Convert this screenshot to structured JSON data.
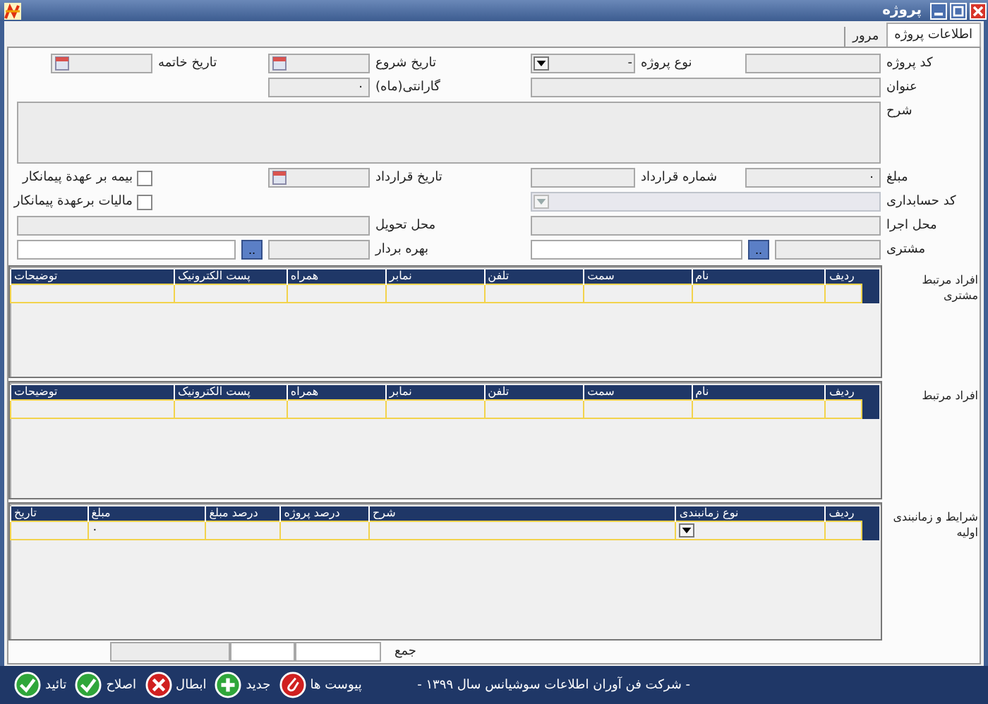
{
  "window": {
    "title": "پروژه"
  },
  "tabs": [
    {
      "label": "اطلاعات پروژه",
      "selected": true
    },
    {
      "label": "مرور",
      "selected": false
    }
  ],
  "fields": {
    "project_code": {
      "label": "کد پروژه"
    },
    "project_type": {
      "label": "نوع پروژه",
      "value": "-"
    },
    "start_date": {
      "label": "تاریخ شروع"
    },
    "end_date": {
      "label": "تاریخ خاتمه"
    },
    "title": {
      "label": "عنوان"
    },
    "warranty": {
      "label": "گارانتی(ماه)",
      "value": "٠"
    },
    "description": {
      "label": "شرح"
    },
    "amount": {
      "label": "مبلغ",
      "value": "٠"
    },
    "contract_number": {
      "label": "شماره قرارداد"
    },
    "contract_date": {
      "label": "تاریخ قرارداد"
    },
    "accounting_code": {
      "label": "کد حسابداری",
      "disabled": true
    },
    "execution_place": {
      "label": "محل اجرا"
    },
    "delivery_place": {
      "label": "محل تحویل"
    },
    "customer": {
      "label": "مشتری",
      "button": ".."
    },
    "operator": {
      "label": "بهره بردار",
      "button": ".."
    }
  },
  "checkboxes": [
    {
      "label": "بیمه بر عهدة پیمانکار",
      "checked": false
    },
    {
      "label": "مالیات برعهدة پیمانکار",
      "checked": false
    }
  ],
  "grids": [
    {
      "label": "افراد مرتبط مشتری",
      "new_row": true,
      "columns": [
        {
          "name": "ردیف"
        },
        {
          "name": "نام"
        },
        {
          "name": "سمت"
        },
        {
          "name": "تلفن"
        },
        {
          "name": "نمابر"
        },
        {
          "name": "همراه"
        },
        {
          "name": "پست الکترونیک"
        },
        {
          "name": "توضیحات"
        }
      ]
    },
    {
      "label": "افراد مرتبط",
      "new_row": true,
      "columns": [
        {
          "name": "ردیف"
        },
        {
          "name": "نام"
        },
        {
          "name": "سمت"
        },
        {
          "name": "تلفن"
        },
        {
          "name": "نمابر"
        },
        {
          "name": "همراه"
        },
        {
          "name": "پست الکترونیک"
        },
        {
          "name": "توضیحات"
        }
      ]
    },
    {
      "label": "شرایط و زمانبندی اولیه",
      "new_row": true,
      "columns": [
        {
          "name": "ردیف"
        },
        {
          "name": "نوع زمانبندی",
          "kind": "dropdown"
        },
        {
          "name": "شرح"
        },
        {
          "name": "درصد پروژه"
        },
        {
          "name": "درصد مبلغ"
        },
        {
          "name": "مبلغ",
          "new_row_value": "٠"
        },
        {
          "name": "تاریخ"
        }
      ]
    }
  ],
  "sum": {
    "label": "جمع"
  },
  "status_text": "- شرکت فن آوران اطلاعات سوشیانس سال ۱۳۹۹ -",
  "toolbar": [
    {
      "label": "پیوست ها",
      "kind": "clip"
    },
    {
      "label": "جدید",
      "kind": "plus"
    },
    {
      "label": "ابطال",
      "kind": "cross"
    },
    {
      "label": "اصلاح",
      "kind": "check"
    },
    {
      "label": "تائید",
      "kind": "check"
    }
  ]
}
